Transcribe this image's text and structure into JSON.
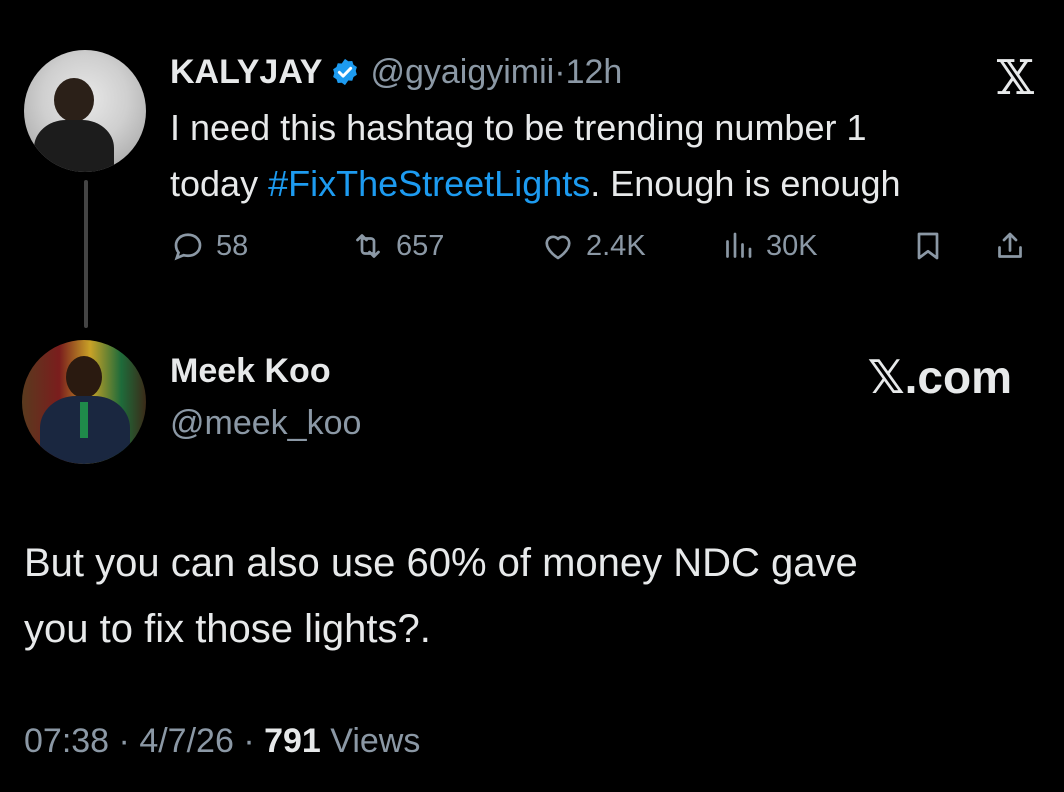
{
  "parent_tweet": {
    "display_name": "KALYJAY",
    "handle": "@gyaigyimii",
    "separator": "·",
    "time": "12h",
    "text_line1": "I need this hashtag to be trending number 1",
    "text_prefix": "today ",
    "hashtag": "#FixTheStreetLights",
    "text_suffix": ". Enough is enough",
    "stats": {
      "replies": "58",
      "retweets": "657",
      "likes": "2.4K",
      "views": "30K"
    },
    "icons": [
      "verified-badge-icon",
      "reply-icon",
      "retweet-icon",
      "like-icon",
      "views-icon",
      "bookmark-icon",
      "share-icon",
      "x-logo-icon"
    ]
  },
  "brand": {
    "x_logo": "𝕏",
    "x_com": "𝕏.com"
  },
  "reply": {
    "display_name": "Meek Koo",
    "handle": "@meek_koo",
    "text_line1": "But you can also use 60% of money NDC gave",
    "text_line2": "you to fix those lights?.",
    "time": "07:38",
    "date": "4/7/26",
    "separator": "·",
    "views_count": "791",
    "views_label": "Views"
  },
  "colors": {
    "background": "#000000",
    "text": "#e7e9ea",
    "muted": "#8b98a5",
    "accent": "#1d9bf0"
  }
}
